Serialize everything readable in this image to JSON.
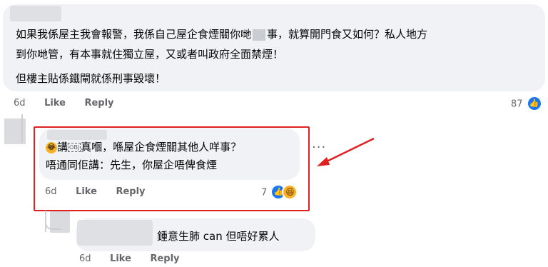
{
  "comment1": {
    "line1": "如果我係屋主我會報警，我係自己屋企食煙關你哋",
    "line1_end": "事，就算開門食又如何？私人地方",
    "line2": "到你哋管，有本事就住獨立屋，又或者叫政府全面禁煙！",
    "line3": "但樓主貼係鐵閘就係刑事毀壞！",
    "time": "6d",
    "like": "Like",
    "reply": "Reply",
    "reaction_count": "87"
  },
  "reply1": {
    "line1_prefix": "講",
    "line1_main": "真嗰，喺屋企食煙關其他人咩事？",
    "line2": "唔通同佢講：先生，你屋企唔俾食煙",
    "time": "6d",
    "like": "Like",
    "reply": "Reply",
    "reaction_count": "7",
    "more": "···"
  },
  "reply2": {
    "text": "鍾意生肺 can 但唔好累人",
    "time": "6d",
    "like": "Like",
    "reply": "Reply"
  },
  "colors": {
    "accent": "#1877f2",
    "highlight": "#e02020",
    "bubble": "#f0f2f5"
  }
}
